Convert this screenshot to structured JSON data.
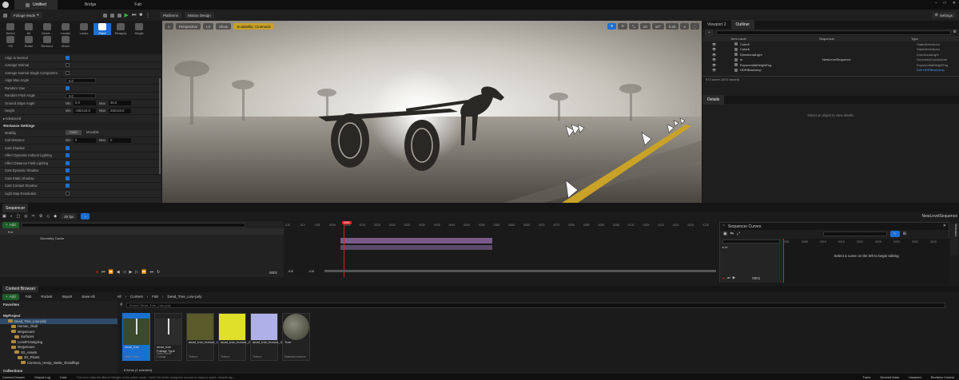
{
  "titlebar": {
    "tabs": [
      {
        "label": "Untitled"
      },
      {
        "label": "Bridge"
      },
      {
        "label": "Fab"
      }
    ]
  },
  "toolbar": {
    "mode": "Foliage Mode",
    "platforms": "Platforms",
    "motion_design": "Motion Design",
    "settings": "Settings"
  },
  "tools": [
    "Select",
    "All",
    "Desel...",
    "Invalid",
    "Lasso",
    "Paint",
    "Reapply",
    "Single",
    "Fill",
    "Erase",
    "Remove",
    "Move"
  ],
  "details_left": {
    "props": [
      {
        "label": "Align to Normal",
        "type": "check",
        "on": true
      },
      {
        "label": "Average Normal",
        "type": "check",
        "on": false
      },
      {
        "label": "Average Normal Single Component",
        "type": "check",
        "on": false
      },
      {
        "label": "Align Max Angle",
        "type": "val",
        "value": "0.0"
      },
      {
        "label": "Random Yaw",
        "type": "check",
        "on": true
      },
      {
        "label": "Random Pitch Angle",
        "type": "val",
        "value": "0.0"
      },
      {
        "label": "Ground Slope Angle",
        "type": "range",
        "min": "0.0",
        "max": "45.0"
      },
      {
        "label": "Height",
        "type": "range",
        "min": "-262144.0",
        "max": "262144.0"
      }
    ],
    "advanced": "Advanced",
    "instance_settings": "Instance Settings",
    "mobility_label": "Mobility",
    "mobility_static": "Static",
    "mobility_movable": "Movable",
    "cull_distance": {
      "label": "Cull Distance",
      "min": "0",
      "max": "0"
    },
    "instance_props": [
      {
        "label": "Cast Shadow",
        "on": true
      },
      {
        "label": "Affect Dynamic Indirect Lighting",
        "on": true
      },
      {
        "label": "Affect Distance Field Lighting",
        "on": true
      },
      {
        "label": "Cast Dynamic Shadow",
        "on": true
      },
      {
        "label": "Cast Static Shadow",
        "on": true
      },
      {
        "label": "Cast Contact Shadow",
        "on": true
      },
      {
        "label": "Light Map Resolution",
        "on": false
      }
    ]
  },
  "viewport": {
    "perspective": "Perspective",
    "lit": "Lit",
    "show": "Show",
    "scalability": "Scalability: Cinematic",
    "grid": "10",
    "angle": "10°",
    "scale": "0.25",
    "speed": "4"
  },
  "outliner": {
    "tabs": [
      "Viewport 2",
      "Outliner"
    ],
    "cols": [
      "Item Label",
      "Sequencer",
      "Type"
    ],
    "rows": [
      {
        "label": "Cube5",
        "seq": "",
        "type": "StaticMeshActor"
      },
      {
        "label": "Cube6",
        "seq": "",
        "type": "StaticMeshActor"
      },
      {
        "label": "DirectionalLight",
        "seq": "",
        "type": "DirectionalLight"
      },
      {
        "label": "er",
        "seq": "NewLevelSequence",
        "type": "GeometryCacheActor"
      },
      {
        "label": "ExponentialHeightFog",
        "seq": "",
        "type": "ExponentialHeightFog"
      },
      {
        "label": "HDRIBackdrop",
        "seq": "",
        "type": "Edit HDRIBackdrop"
      }
    ],
    "status": "573 actors (515 loaded)",
    "details_tab": "Details",
    "details_empty": "Select an object to view details."
  },
  "sequencer": {
    "tab": "Sequencer",
    "fps": "30 fps",
    "name": "NewLevelSequence",
    "add": "Add",
    "track": "Geometry Cache",
    "frame": "0001",
    "start": "-015",
    "end": "-015",
    "ticks": [
      "-015",
      "-010",
      "-005",
      "0000",
      "0005",
      "0010",
      "0015",
      "0020",
      "0025",
      "0030",
      "0035",
      "0040",
      "0045",
      "0050",
      "0055",
      "0060",
      "0065",
      "0070",
      "0075",
      "0080",
      "0085",
      "0090",
      "0095",
      "0100",
      "0105",
      "0110",
      "0115",
      "0120",
      "0125"
    ],
    "curves": {
      "tab": "Sequencer Curves",
      "item": "er",
      "empty": "Select a curve on the left to begin editing",
      "frame": "0001",
      "ticks": [
        "0001",
        "0005",
        "0010",
        "0015",
        "0020",
        "0025",
        "0030",
        "0035",
        "0040"
      ]
    },
    "selection": "Selection"
  },
  "content_browser": {
    "tab": "Content Browser",
    "add": "Add",
    "fab": "Fab",
    "rocket": "Rocket",
    "import": "Import",
    "save_all": "Save All",
    "path": [
      "All",
      "Content",
      "Fab",
      "Dead_Tree_Low-poly"
    ],
    "search": "Search Dead_Tree_Low-poly",
    "favorites": "Favorites",
    "project": "MyProject",
    "folders": [
      "Dead_Tree_Low-poly",
      "Human_Skull",
      "Megascans",
      "Surfaces",
      "LevelPrototyping",
      "Megascans",
      "3D_Assets",
      "3D_Plants",
      "Common_Hemp_Nettle_sh1kdfbgs"
    ],
    "items": [
      {
        "name": "dead_tree",
        "type": "Static Mesh",
        "color": "#3a4a2a"
      },
      {
        "name": "dead_tree Foliage Type",
        "type": "Static Mesh Foliage",
        "color": "#2c2c2c"
      },
      {
        "name": "dead_tree_texture_1",
        "type": "Texture",
        "color": "#5a5a2a"
      },
      {
        "name": "dead_tree_texture_2",
        "type": "Texture",
        "color": "#e0e02a"
      },
      {
        "name": "dead_tree_texture_3",
        "type": "Texture",
        "color": "#b0b0e8"
      },
      {
        "name": "Tree",
        "type": "Material Instance",
        "color": "#6a6a5a"
      }
    ],
    "count": "6 items (1 selected)",
    "collections": "Collections"
  },
  "statusbar": {
    "items": [
      "Content Drawer",
      "Output Log",
      "Cmd"
    ],
    "hint": "This tool edits the Blend Weight of the paint mode, Hold Ctrl while using the mouse to draw to paint; double-tap...",
    "right": [
      "Trace",
      "Derived Data",
      "Unsaved",
      "Revision Control"
    ]
  },
  "colors": {
    "accent": "#1b6fd0",
    "playhead": "#e02020"
  }
}
